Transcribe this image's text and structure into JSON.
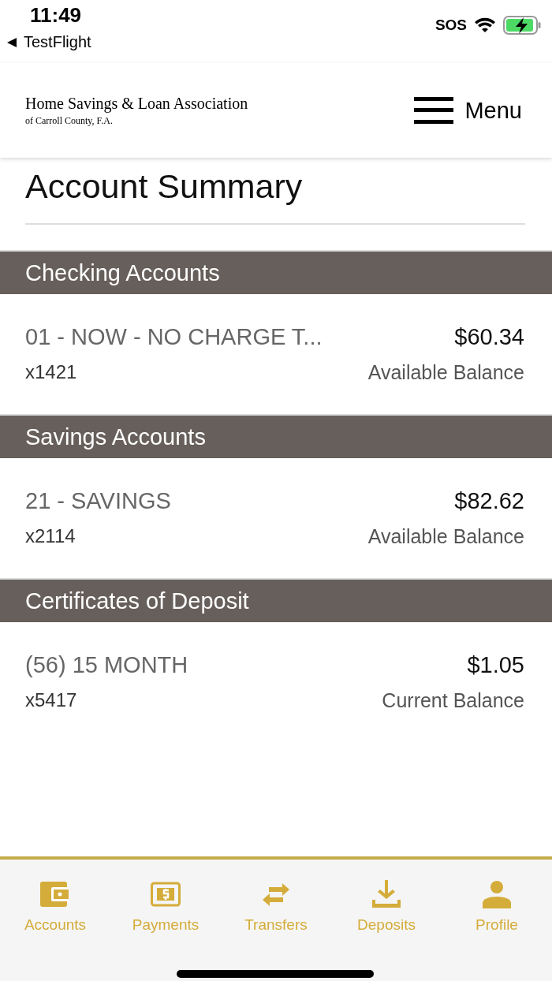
{
  "status_bar": {
    "time": "11:49",
    "back_label": "TestFlight",
    "carrier": "SOS"
  },
  "header": {
    "bank_name": "Home Savings & Loan Association",
    "bank_subtitle": "of Carroll County, F.A.",
    "menu_label": "Menu"
  },
  "title": "Account Summary",
  "sections": [
    {
      "title": "Checking Accounts",
      "accounts": [
        {
          "name": "01 - NOW - NO CHARGE T...",
          "number": "x1421",
          "amount": "$60.34",
          "balance_label": "Available Balance"
        }
      ]
    },
    {
      "title": "Savings Accounts",
      "accounts": [
        {
          "name": "21 - SAVINGS",
          "number": "x2114",
          "amount": "$82.62",
          "balance_label": "Available Balance"
        }
      ]
    },
    {
      "title": "Certificates of Deposit",
      "accounts": [
        {
          "name": "(56) 15 MONTH",
          "number": "x5417",
          "amount": "$1.05",
          "balance_label": "Current Balance"
        }
      ]
    }
  ],
  "tab_bar": [
    {
      "kind": "wallet",
      "label": "Accounts"
    },
    {
      "kind": "dollar",
      "label": "Payments"
    },
    {
      "kind": "swap",
      "label": "Transfers"
    },
    {
      "kind": "download",
      "label": "Deposits"
    },
    {
      "kind": "person",
      "label": "Profile"
    }
  ]
}
